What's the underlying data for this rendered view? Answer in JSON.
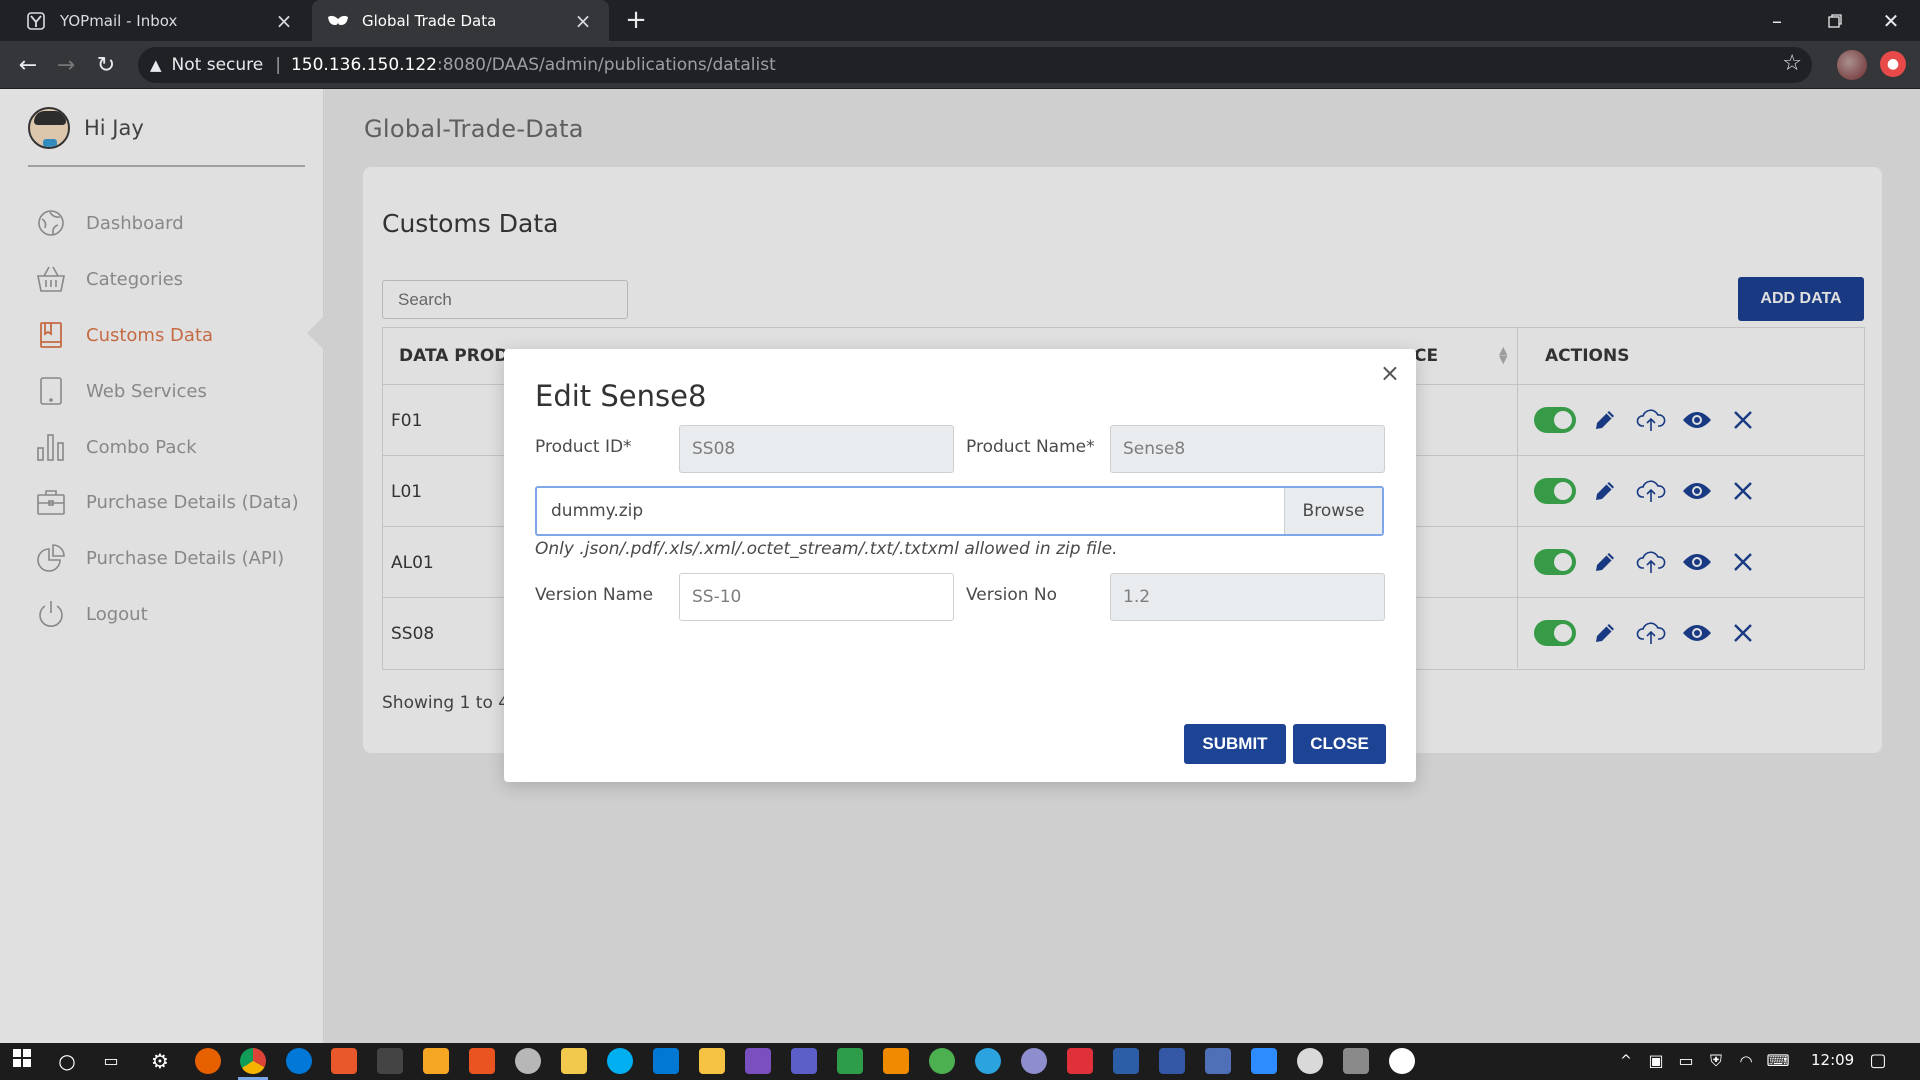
{
  "browser": {
    "tabs": [
      {
        "title": "YOPmail - Inbox",
        "active": false
      },
      {
        "title": "Global Trade Data",
        "active": true
      }
    ],
    "security": "Not secure",
    "url_host": "150.136.150.122",
    "url_rest": ":8080/DAAS/admin/publications/datalist"
  },
  "user": {
    "greeting": "Hi Jay"
  },
  "sidebar": {
    "items": [
      {
        "label": "Dashboard",
        "icon": "dashboard-icon",
        "active": false
      },
      {
        "label": "Categories",
        "icon": "basket-icon",
        "active": false
      },
      {
        "label": "Customs Data",
        "icon": "book-icon",
        "active": true
      },
      {
        "label": "Web Services",
        "icon": "tablet-icon",
        "active": false
      },
      {
        "label": "Combo Pack",
        "icon": "bar-chart-icon",
        "active": false
      },
      {
        "label": "Purchase Details (Data)",
        "icon": "briefcase-icon",
        "active": false
      },
      {
        "label": "Purchase Details (API)",
        "icon": "pie-chart-icon",
        "active": false
      },
      {
        "label": "Logout",
        "icon": "power-icon",
        "active": false
      }
    ]
  },
  "main": {
    "page_title": "Global-Trade-Data",
    "card_title": "Customs Data",
    "search_placeholder": "Search",
    "add_button": "ADD DATA",
    "columns": {
      "product": "DATA PROD",
      "price": "CE",
      "actions": "ACTIONS"
    },
    "rows": [
      {
        "id": "F01"
      },
      {
        "id": "L01"
      },
      {
        "id": "AL01"
      },
      {
        "id": "SS08"
      }
    ],
    "showing": "Showing 1 to 4"
  },
  "modal": {
    "title": "Edit Sense8",
    "product_id_label": "Product ID*",
    "product_id_value": "SS08",
    "product_name_label": "Product Name*",
    "product_name_value": "Sense8",
    "file_value": "dummy.zip",
    "browse_label": "Browse",
    "file_hint": "Only .json/.pdf/.xls/.xml/.octet_stream/.txt/.txtxml allowed in zip file.",
    "version_name_label": "Version Name",
    "version_name_value": "SS-10",
    "version_no_label": "Version No",
    "version_no_value": "1.2",
    "submit_label": "SUBMIT",
    "close_label": "CLOSE"
  },
  "taskbar": {
    "time": "12:09"
  },
  "colors": {
    "primary": "#1d4394",
    "active_nav": "#e07a4f",
    "toggle_on": "#3fb050"
  }
}
